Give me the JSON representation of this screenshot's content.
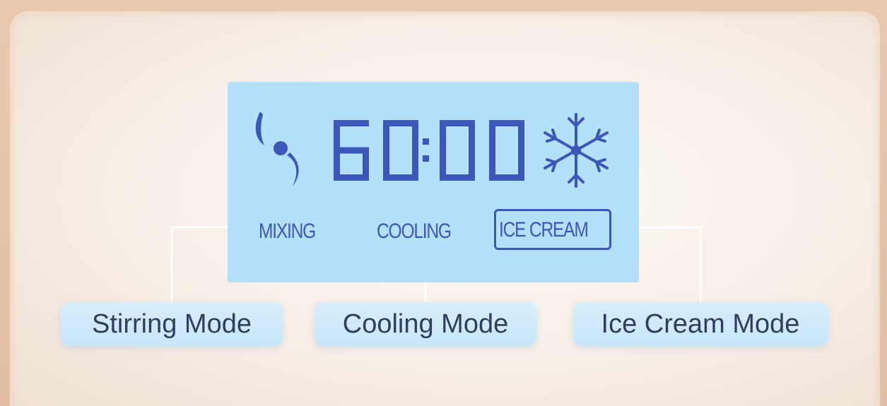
{
  "display": {
    "time": "60:00",
    "mode_labels": {
      "mixing": "MIXING",
      "cooling": "COOLING",
      "ice_cream": "ICE CREAM"
    },
    "selected_mode": "ice_cream",
    "icons": [
      "mixing-paddle-icon",
      "snowflake-icon"
    ]
  },
  "callouts": {
    "stirring": "Stirring Mode",
    "cooling": "Cooling Mode",
    "ice_cream": "Ice Cream Mode"
  },
  "colors": {
    "lcd_background": "#b5e0fb",
    "lcd_segments": "#3b57b8",
    "callout_background": "#d2ebfb",
    "callout_text": "#2f3e5c",
    "panel_border": "#e2bfa4"
  }
}
